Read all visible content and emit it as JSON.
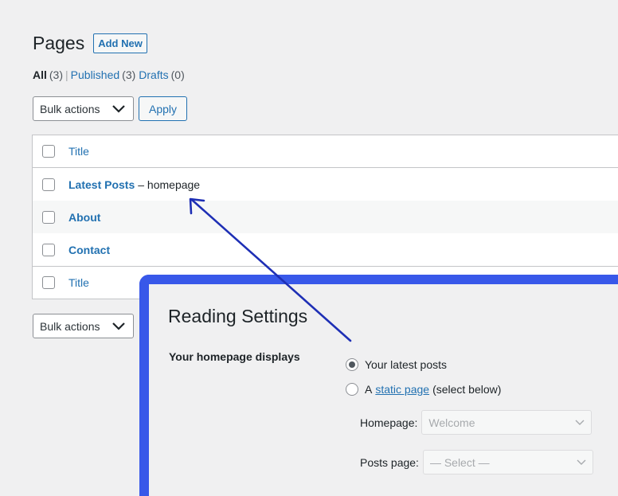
{
  "header": {
    "title": "Pages",
    "add_new": "Add New"
  },
  "filters": {
    "all_label": "All",
    "all_count": "(3)",
    "published_label": "Published",
    "published_count": "(3)",
    "drafts_label": "Drafts",
    "drafts_count": "(0)",
    "sep": "|"
  },
  "bulk": {
    "label": "Bulk actions",
    "apply": "Apply"
  },
  "table": {
    "header_title": "Title",
    "footer_title": "Title",
    "rows": [
      {
        "title": "Latest Posts",
        "state": "– homepage"
      },
      {
        "title": "About"
      },
      {
        "title": "Contact"
      }
    ]
  },
  "reading": {
    "title": "Reading Settings",
    "field_label": "Your homepage displays",
    "option_latest": "Your latest posts",
    "option_static_prefix": "A",
    "option_static_link": "static page",
    "option_static_suffix": "(select below)",
    "homepage_label": "Homepage:",
    "homepage_value": "Welcome",
    "posts_label": "Posts page:",
    "posts_value": "— Select —"
  },
  "colors": {
    "accent": "#2271b1",
    "panel_border": "#3858e9",
    "annotation_arrow": "#1e2fb5"
  },
  "icons": {
    "dropdown": "chevron-down-icon",
    "annotation": "arrow-annotation"
  }
}
